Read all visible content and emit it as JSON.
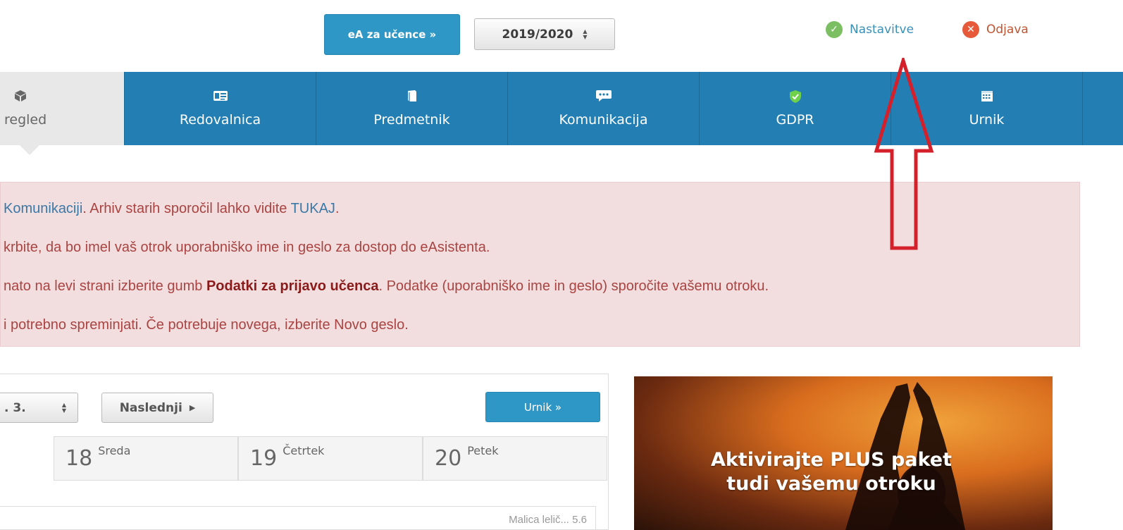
{
  "topbar": {
    "ea_button": "eA za učence »",
    "year": "2019/2020",
    "settings_label": "Nastavitve",
    "logout_label": "Odjava"
  },
  "nav": {
    "items": [
      {
        "label": "regled",
        "icon": "cube-icon",
        "active": true
      },
      {
        "label": "Redovalnica",
        "icon": "id-card-icon"
      },
      {
        "label": "Predmetnik",
        "icon": "book-icon"
      },
      {
        "label": "Komunikacija",
        "icon": "speech-bubble-icon"
      },
      {
        "label": "GDPR",
        "icon": "shield-icon"
      },
      {
        "label": "Urnik",
        "icon": "calendar-icon"
      }
    ]
  },
  "alert": {
    "line1_a": "Komunikaciji",
    "line1_b": ". Arhiv starih sporočil lahko vidite ",
    "line1_link": "TUKAJ",
    "line1_c": ".",
    "line2": "krbite, da bo imel vaš otrok uporabniško ime in geslo za dostop do eAsistenta.",
    "line3_a": "nato na levi strani izberite gumb ",
    "line3_bold": "Podatki za prijavo učenca",
    "line3_c": ". Podatke (uporabniško ime in geslo) sporočite vašemu otroku.",
    "line4": "i potrebno spreminjati. Če potrebuje novega, izberite Novo geslo."
  },
  "calendar": {
    "date_select": ". 3.",
    "next_label": "Naslednji",
    "urnik_button": "Urnik »",
    "days": [
      {
        "num": "18",
        "name": "Sreda"
      },
      {
        "num": "19",
        "name": "Četrtek"
      },
      {
        "num": "20",
        "name": "Petek"
      }
    ],
    "bottom_text": "Malica lelič... 5.6"
  },
  "promo": {
    "line1": "Aktivirajte PLUS paket",
    "line2": "tudi vašemu otroku"
  },
  "colors": {
    "nav_blue": "#237fb3",
    "button_blue": "#2f97c6",
    "alert_bg": "#f2dede",
    "annotation_red": "#d4202a"
  }
}
